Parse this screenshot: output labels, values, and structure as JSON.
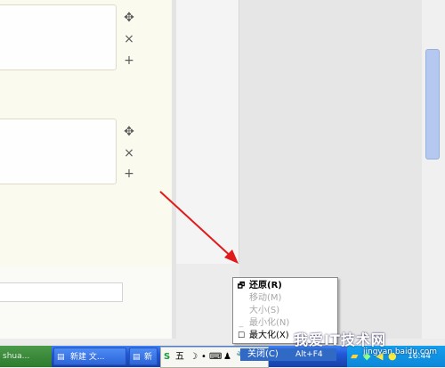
{
  "cards": [
    {
      "controls": [
        "✥",
        "×",
        "+"
      ]
    },
    {
      "controls": [
        "✥",
        "×",
        "+"
      ]
    }
  ],
  "context_menu": {
    "items": [
      {
        "icon": "🗗",
        "label": "还原(R)",
        "state": "bold"
      },
      {
        "icon": "",
        "label": "移动(M)",
        "state": "disabled"
      },
      {
        "icon": "",
        "label": "大小(S)",
        "state": "disabled"
      },
      {
        "icon": "_",
        "label": "最小化(N)",
        "state": "disabled"
      },
      {
        "icon": "☐",
        "label": "最大化(X)",
        "state": "normal"
      },
      {
        "icon": "",
        "label": "关闭(C)",
        "shortcut": "Alt+F4",
        "state": "selected"
      }
    ]
  },
  "taskbar": {
    "start_text": "shua...",
    "tasks": [
      {
        "label": "新建 文..."
      },
      {
        "label": "新"
      }
    ],
    "ime": {
      "mode_char": "五",
      "icons": [
        "S",
        "☽",
        "•",
        "⌨",
        "♟",
        "🔧"
      ]
    },
    "clock": "16:44"
  },
  "watermark": {
    "title": "我爱IT技术网",
    "url": "jingyan.baidu.com"
  },
  "colors": {
    "taskbar": "#2157d7",
    "menu_selected": "#316ac5",
    "scroll_thumb": "#b4c8f0",
    "arrow": "#e01b1b"
  }
}
